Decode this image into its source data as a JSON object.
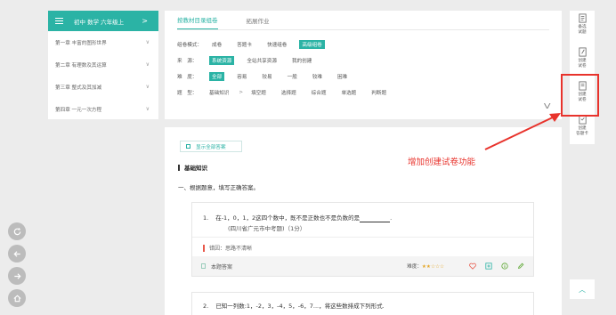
{
  "sidebar": {
    "title": "初中 数学 六年级上",
    "arrow": ">",
    "items": [
      {
        "label": "第一章 丰富的图形世界",
        "chev": "∨"
      },
      {
        "label": "第二章 有理数及其运算",
        "chev": "∨"
      },
      {
        "label": "第三章 整式及其加减",
        "chev": "∨"
      },
      {
        "label": "第四章 一元一次方程",
        "chev": "∨"
      }
    ]
  },
  "panel": {
    "tabs": [
      "按教材目录组卷",
      "拓展作业"
    ],
    "mode": {
      "label": "组卷模式：",
      "options": [
        "成卷",
        "答题卡",
        "快速组卷",
        "高级组卷"
      ]
    },
    "source": {
      "label": "来　源：",
      "options": [
        "系统资源",
        "全站共享资源",
        "我的创建"
      ]
    },
    "difficulty": {
      "label": "难　度：",
      "options": [
        "全部",
        "容易",
        "较易",
        "一般",
        "较难",
        "困难"
      ]
    },
    "qtype": {
      "label": "题　型：",
      "prefix": "基础知识",
      "sep": ">",
      "options": [
        "填空题",
        "选择题",
        "综合题",
        "单选题",
        "判断题"
      ]
    },
    "expand": "V"
  },
  "content": {
    "show_answers": "显示全部答案",
    "section_title": "基础知识",
    "instruction": "一、根据题意，填写正确答案。",
    "q1": {
      "num": "1.",
      "text": "在-1，0，1，2这四个数中，既不是正数也不是负数的是",
      "tail": ".",
      "source": "(四川省广元市中考题)（1分）",
      "error_reason": "错因：思路不清晰",
      "answer_label": "本题答案",
      "difficulty_label": "难度：",
      "stars": "★★☆☆☆"
    },
    "q2": {
      "num": "2.",
      "text": "已知一列数:1，-2，3，-4，5，-6，7...，将这些数排成下列形式."
    }
  },
  "annotation": {
    "text": "增加创建试卷功能",
    "color": "#e8332c"
  },
  "toolbar": {
    "buttons": [
      {
        "label1": "备选",
        "label2": "试题",
        "icon": "basket-icon"
      },
      {
        "label1": "创建",
        "label2": "试卷",
        "icon": "edit-doc-icon"
      },
      {
        "label1": "创建",
        "label2": "试卷",
        "icon": "paper-icon"
      },
      {
        "label1": "创建",
        "label2": "答题卡",
        "icon": "card-icon"
      }
    ],
    "to_top": "︿"
  },
  "floating": [
    "refresh-icon",
    "back-icon",
    "forward-icon",
    "home-icon"
  ],
  "colors": {
    "accent": "#2bb3a5",
    "annotation": "#e8332c",
    "background": "#ececec"
  }
}
